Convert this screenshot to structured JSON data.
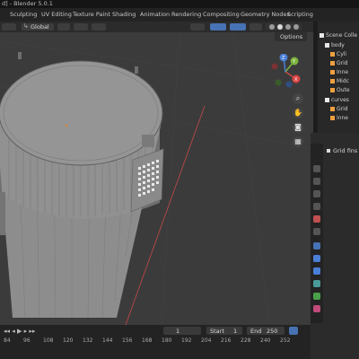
{
  "window": {
    "title": "d] - Blender 5.0.1"
  },
  "workspaces": [
    "Sculpting",
    "UV Editing",
    "Texture Paint",
    "Shading",
    "Animation",
    "Rendering",
    "Compositing",
    "Geometry Nodes",
    "Scripting"
  ],
  "viewport_header": {
    "orientation": "Global",
    "options_label": "Options"
  },
  "gizmo": {
    "x": "X",
    "y": "Y",
    "z": "Z"
  },
  "outliner": {
    "root": "Scene Colle",
    "items": [
      {
        "label": "body",
        "color": "#e8e8e8"
      },
      {
        "label": "Cyli",
        "color": "#f0a040"
      },
      {
        "label": "Grid",
        "color": "#f0a040"
      },
      {
        "label": "Inne",
        "color": "#f0a040"
      },
      {
        "label": "Midc",
        "color": "#f0a040"
      },
      {
        "label": "Oute",
        "color": "#f0a040"
      },
      {
        "label": "curves",
        "color": "#e8e8e8"
      },
      {
        "label": "Grid",
        "color": "#f0a040"
      },
      {
        "label": "inne",
        "color": "#f0a040"
      }
    ]
  },
  "properties": {
    "object_name": "Grid fins"
  },
  "timeline": {
    "current_frame": "1",
    "start_label": "Start",
    "start_value": "1",
    "end_label": "End",
    "end_value": "250",
    "frame_numbers": [
      "84",
      "96",
      "108",
      "120",
      "132",
      "144",
      "156",
      "168",
      "180",
      "192",
      "204",
      "216",
      "228",
      "240",
      "252"
    ]
  },
  "colors": {
    "accent": "#4772b3",
    "viewport_bg": "#3b3b3b",
    "x_axis": "#d94545",
    "y_axis": "#7bb43c",
    "z_axis": "#4a7fd6"
  }
}
